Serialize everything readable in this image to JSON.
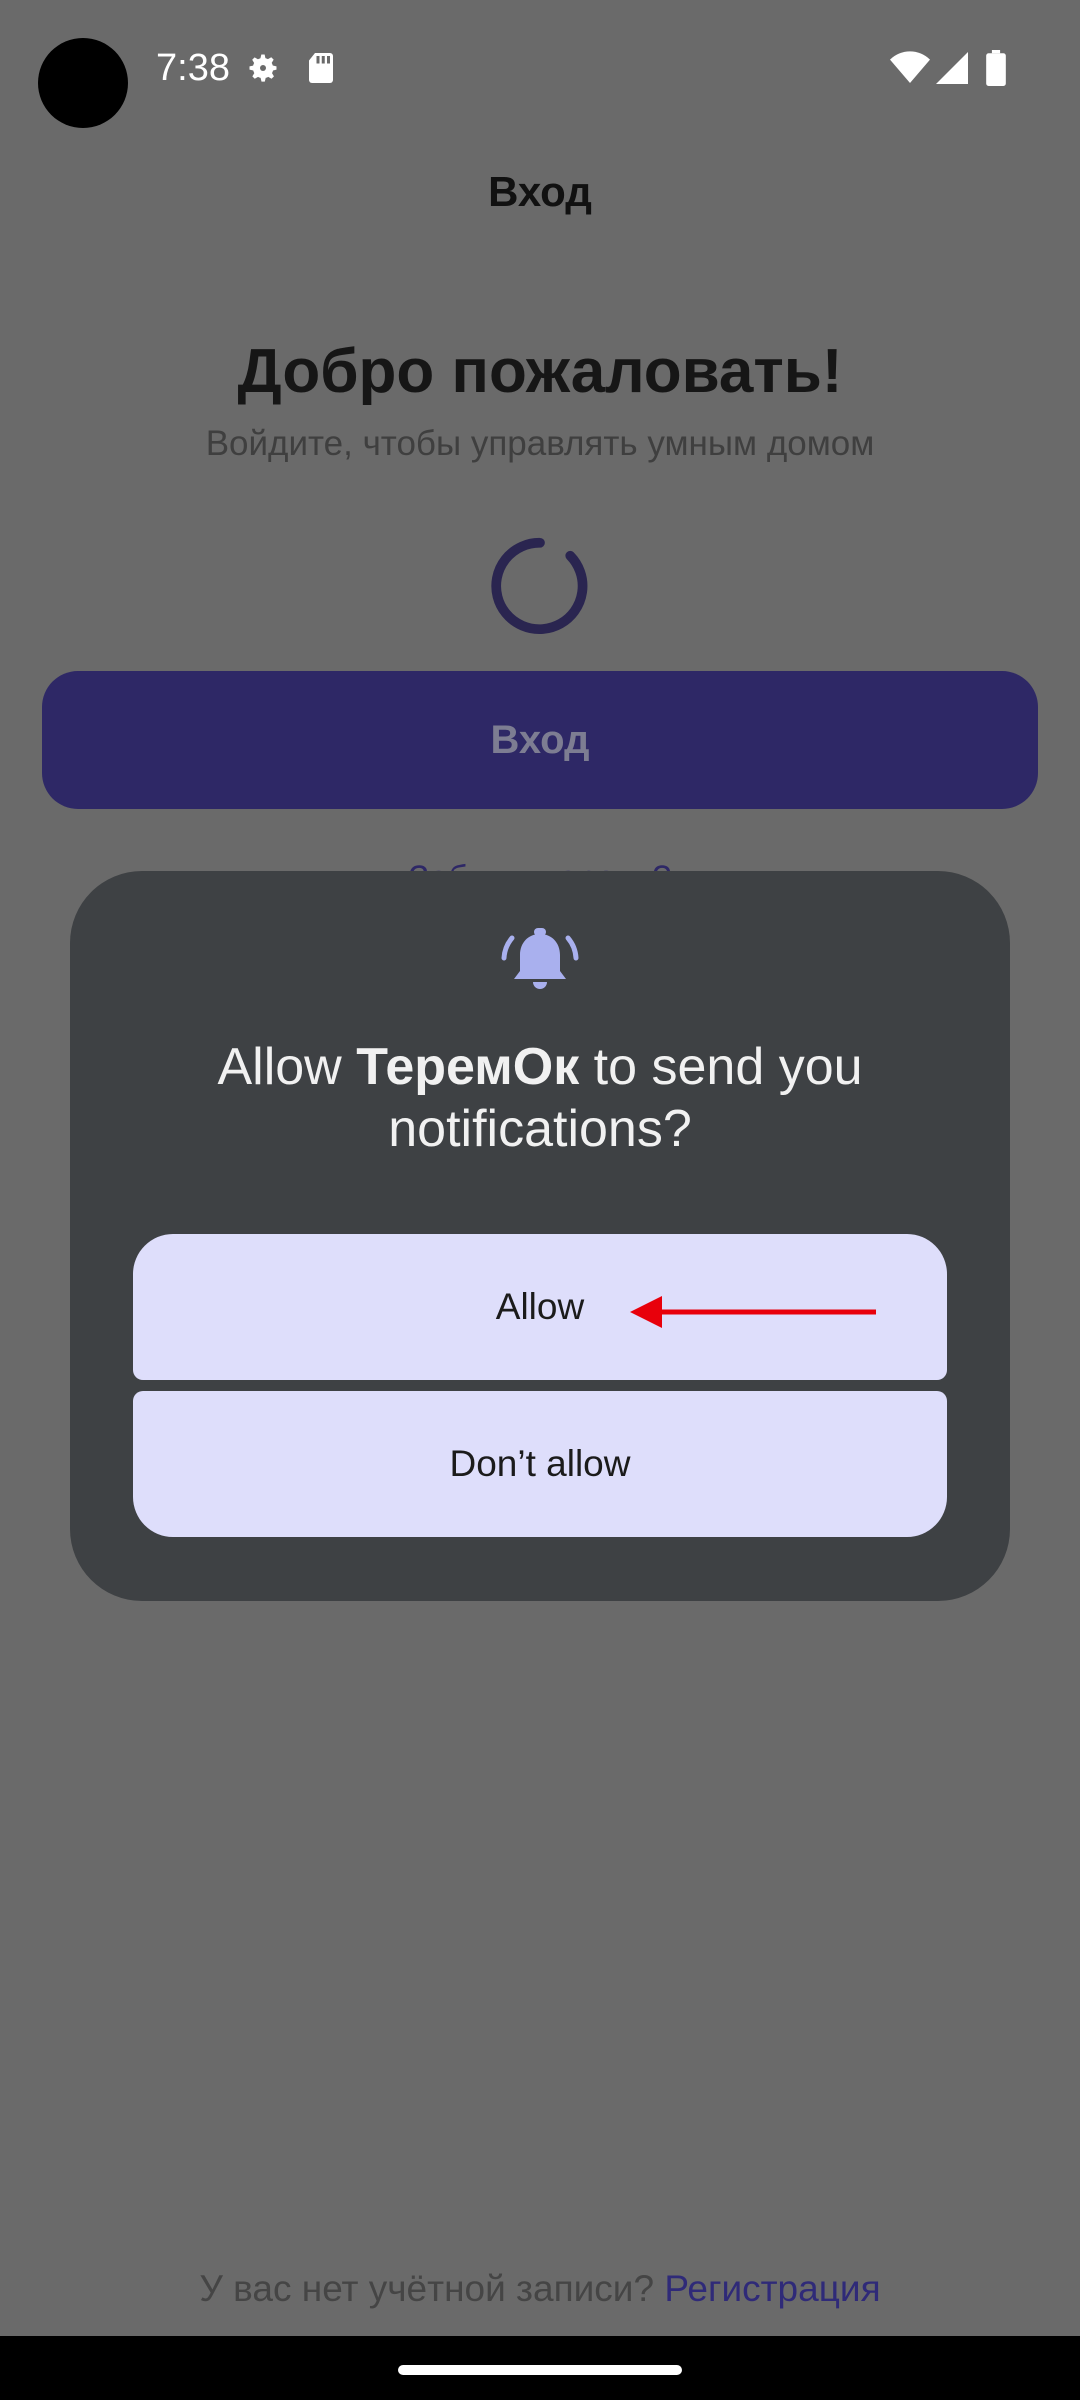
{
  "status_bar": {
    "time": "7:38",
    "icons": [
      "settings-icon",
      "sd-card-icon",
      "wifi-icon",
      "signal-icon",
      "battery-icon"
    ]
  },
  "login_screen": {
    "app_bar_title": "Вход",
    "welcome": "Добро пожаловать!",
    "subtitle": "Войдите, чтобы управлять умным домом",
    "login_button": "Вход",
    "forgot_password_partial": "Забыли пароль?",
    "no_account_text": "У вас нет учётной записи?",
    "register_link": "Регистрация"
  },
  "permission_dialog": {
    "icon": "bell-icon",
    "title_prefix": "Allow ",
    "app_name": "ТеремОк",
    "title_suffix": " to send you notifications?",
    "allow_label": "Allow",
    "deny_label": "Don’t allow"
  },
  "colors": {
    "scrim": "#6a6a6a",
    "dialog_bg": "#3e4144",
    "button_bg": "#dedefb",
    "accent": "#2e2866",
    "arrow": "#e8000b"
  }
}
